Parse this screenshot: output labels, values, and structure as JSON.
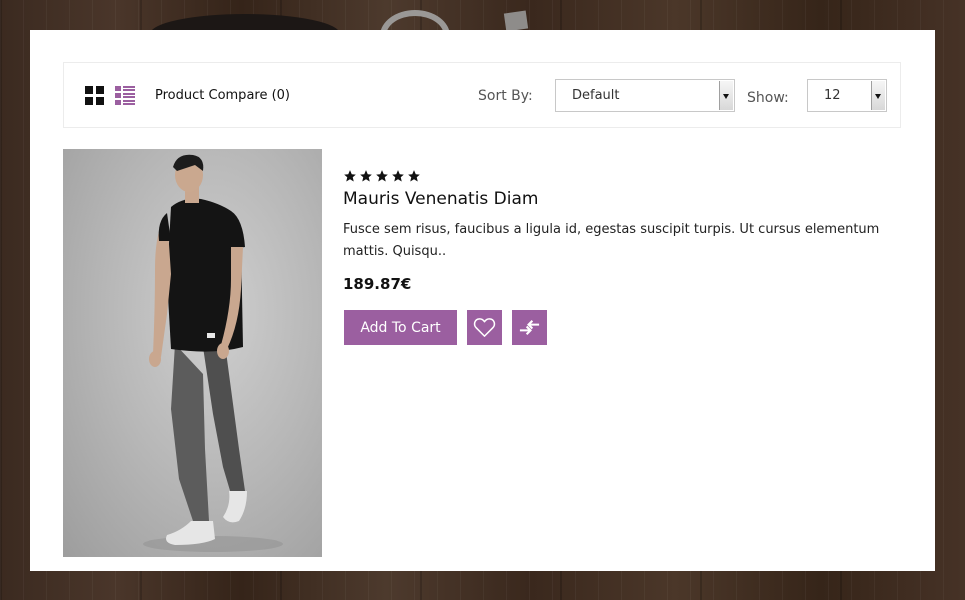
{
  "toolbar": {
    "compare_label": "Product Compare (0)",
    "sort_label": "Sort By:",
    "sort_value": "Default",
    "show_label": "Show:",
    "show_value": "12",
    "view_icons": [
      "grid-view-icon",
      "list-view-icon"
    ]
  },
  "product": {
    "rating": 5,
    "rating_max": 5,
    "name": "Mauris Venenatis Diam",
    "description": "Fusce sem risus, faucibus a ligula id, egestas suscipit turpis. Ut cursus elementum mattis. Quisqu..",
    "price": "189.87€",
    "add_to_cart_label": "Add To Cart",
    "action_icons": [
      "heart-icon",
      "compare-arrows-icon"
    ]
  },
  "colors": {
    "accent": "#9b5fa0",
    "panel_bg": "#ffffff",
    "background": "#3b2a20"
  }
}
